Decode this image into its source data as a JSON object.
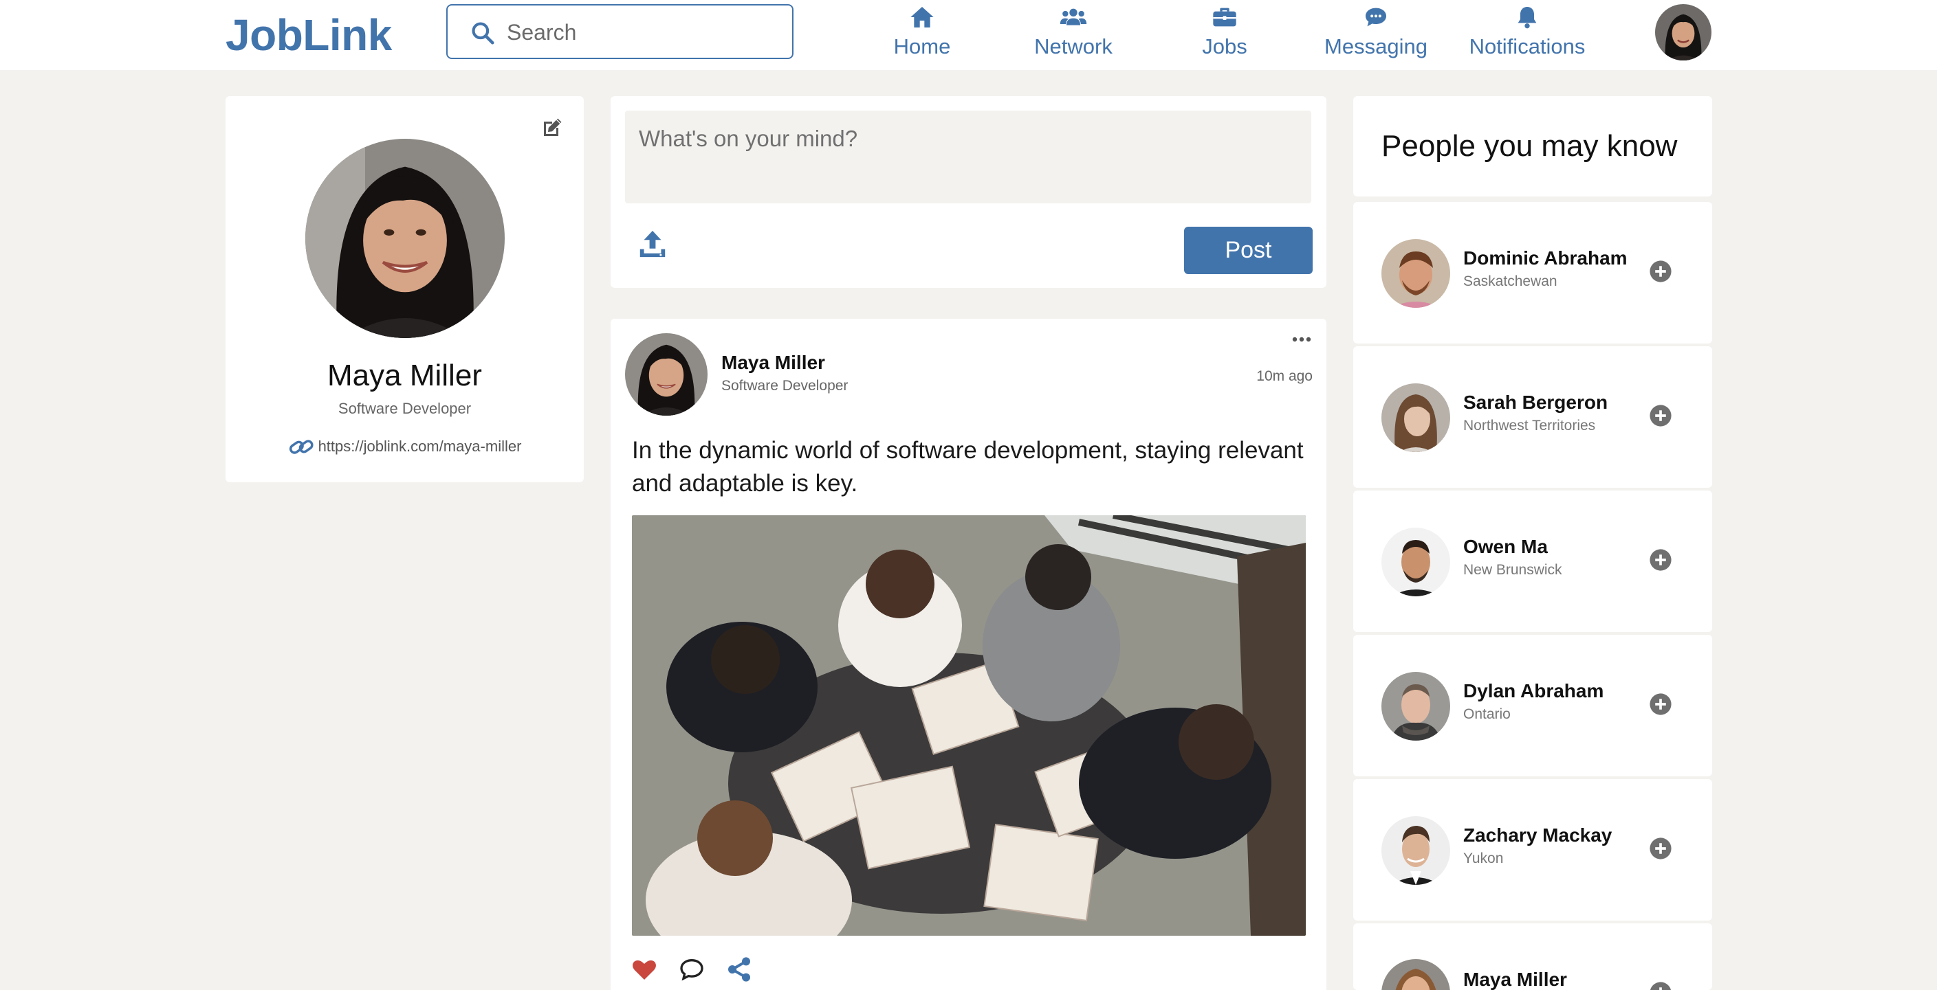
{
  "header": {
    "logo": "JobLink",
    "search": {
      "placeholder": "Search",
      "value": ""
    },
    "nav": [
      {
        "label": "Home",
        "icon": "home-icon"
      },
      {
        "label": "Network",
        "icon": "network-icon"
      },
      {
        "label": "Jobs",
        "icon": "briefcase-icon"
      },
      {
        "label": "Messaging",
        "icon": "chat-icon"
      },
      {
        "label": "Notifications",
        "icon": "bell-icon"
      }
    ]
  },
  "profile": {
    "name": "Maya Miller",
    "title": "Software Developer",
    "link": "https://joblink.com/maya-miller"
  },
  "composer": {
    "placeholder": "What's on your mind?",
    "post_label": "Post"
  },
  "post": {
    "author": "Maya Miller",
    "author_title": "Software Developer",
    "time": "10m ago",
    "text": "In the dynamic world of software development, staying relevant and adaptable is key."
  },
  "suggestions": {
    "title": "People you may know",
    "people": [
      {
        "name": "Dominic Abraham",
        "location": "Saskatchewan"
      },
      {
        "name": "Sarah Bergeron",
        "location": "Northwest Territories"
      },
      {
        "name": "Owen Ma",
        "location": "New Brunswick"
      },
      {
        "name": "Dylan Abraham",
        "location": "Ontario"
      },
      {
        "name": "Zachary Mackay",
        "location": "Yukon"
      },
      {
        "name": "Maya Miller",
        "location": ""
      }
    ]
  },
  "colors": {
    "brand": "#4274ac",
    "page_bg": "#f3f2ef",
    "like": "#c9473d"
  }
}
